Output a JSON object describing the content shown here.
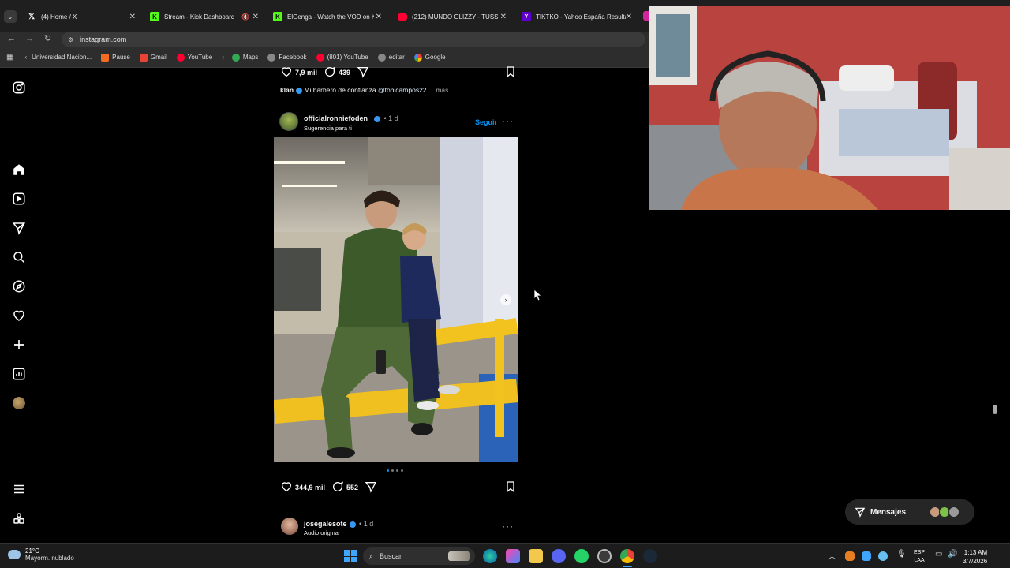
{
  "browser": {
    "tabs": [
      {
        "title": "(4) Home / X",
        "icon": "x-icon"
      },
      {
        "title": "Stream - Kick Dashboard",
        "icon": "kick-icon"
      },
      {
        "title": "ElGenga - Watch the VOD on K",
        "icon": "kick-icon"
      },
      {
        "title": "(212) MUNDO GLIZZY - TUSSI",
        "icon": "youtube-icon"
      },
      {
        "title": "TIKTKO - Yahoo España Resulta",
        "icon": "yahoo-icon"
      }
    ],
    "url": "instagram.com",
    "bookmarks": [
      {
        "label": "Universidad Nacion..."
      },
      {
        "label": "Pause"
      },
      {
        "label": "Gmail"
      },
      {
        "label": "YouTube"
      },
      {
        "label": "Maps"
      },
      {
        "label": "Facebook"
      },
      {
        "label": "(801) YouTube"
      },
      {
        "label": "editar"
      },
      {
        "label": "Google"
      }
    ]
  },
  "feed": {
    "prev_post": {
      "likes": "7,9 mil",
      "comments": "439",
      "caption_user": "klan",
      "caption_text": "Mi barbero de confianza",
      "caption_mention": "@tobicampos22",
      "caption_more": "... más"
    },
    "post": {
      "username": "officialronniefoden_",
      "time": "• 1 d",
      "subtitle": "Sugerencia para ti",
      "follow": "Seguir",
      "likes": "344,9 mil",
      "comments": "552"
    },
    "next_post": {
      "username": "josegalesote",
      "time": "• 1 d",
      "subtitle": "Audio original"
    }
  },
  "messages": {
    "label": "Mensajes"
  },
  "taskbar": {
    "weather_temp": "21°C",
    "weather_desc": "Mayorm. nublado",
    "search": "Buscar",
    "lang1": "ESP",
    "lang2": "LAA",
    "time": "1:13 AM",
    "date": "3/7/2026"
  }
}
